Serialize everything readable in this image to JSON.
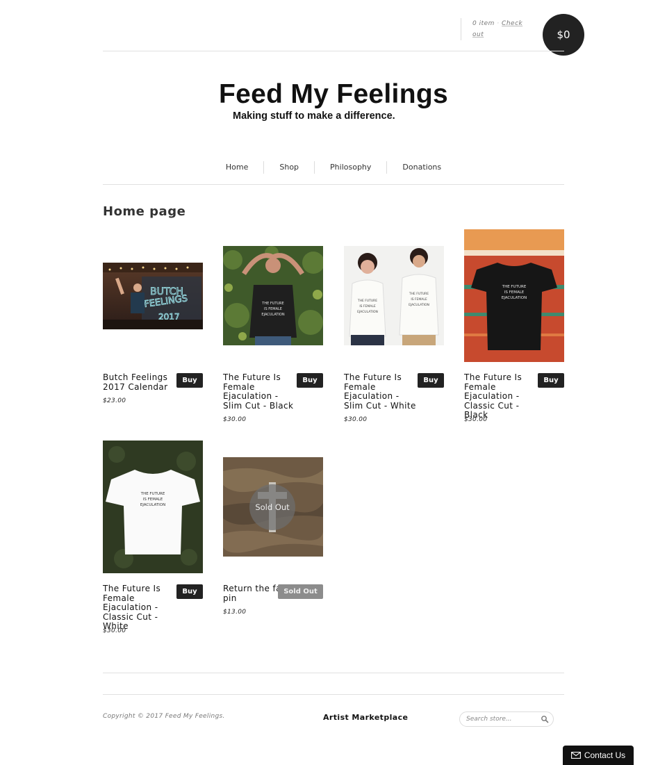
{
  "cart": {
    "count_text": "0 item",
    "separator": "·",
    "checkout_label": "Check out",
    "total": "$0"
  },
  "site": {
    "title": "Feed My Feelings",
    "tagline": "Making stuff to make a difference."
  },
  "nav": {
    "items": [
      "Home",
      "Shop",
      "Philosophy",
      "Donations"
    ]
  },
  "page": {
    "heading": "Home page"
  },
  "products": [
    {
      "name": "Butch Feelings 2017 Calendar",
      "price": "$23.00",
      "button": "Buy",
      "sold_out": false
    },
    {
      "name": "The Future Is Female Ejaculation - Slim Cut - Black",
      "price": "$30.00",
      "button": "Buy",
      "sold_out": false
    },
    {
      "name": "The Future Is Female Ejaculation - Slim Cut - White",
      "price": "$30.00",
      "button": "Buy",
      "sold_out": false
    },
    {
      "name": "The Future Is Female Ejaculation - Classic Cut - Black",
      "price": "$30.00",
      "button": "Buy",
      "sold_out": false
    },
    {
      "name": "The Future Is Female Ejaculation - Classic Cut - White",
      "price": "$30.00",
      "button": "Buy",
      "sold_out": false
    },
    {
      "name": "Return the favor pin",
      "price": "$13.00",
      "button": "Sold Out",
      "sold_out": true,
      "overlay": "Sold Out"
    }
  ],
  "shirt_print": [
    "THE FUTURE",
    "IS FEMALE",
    "EJACULATION"
  ],
  "calendar_sign": [
    "BUTCH",
    "FEELINGS",
    "2017"
  ],
  "footer": {
    "copyright": "Copyright © 2017 Feed My Feelings.",
    "marketplace": "Artist Marketplace",
    "search_placeholder": "Search store...",
    "contact_label": "Contact Us"
  },
  "icons": {
    "search": "search-icon",
    "mail": "mail-icon"
  }
}
